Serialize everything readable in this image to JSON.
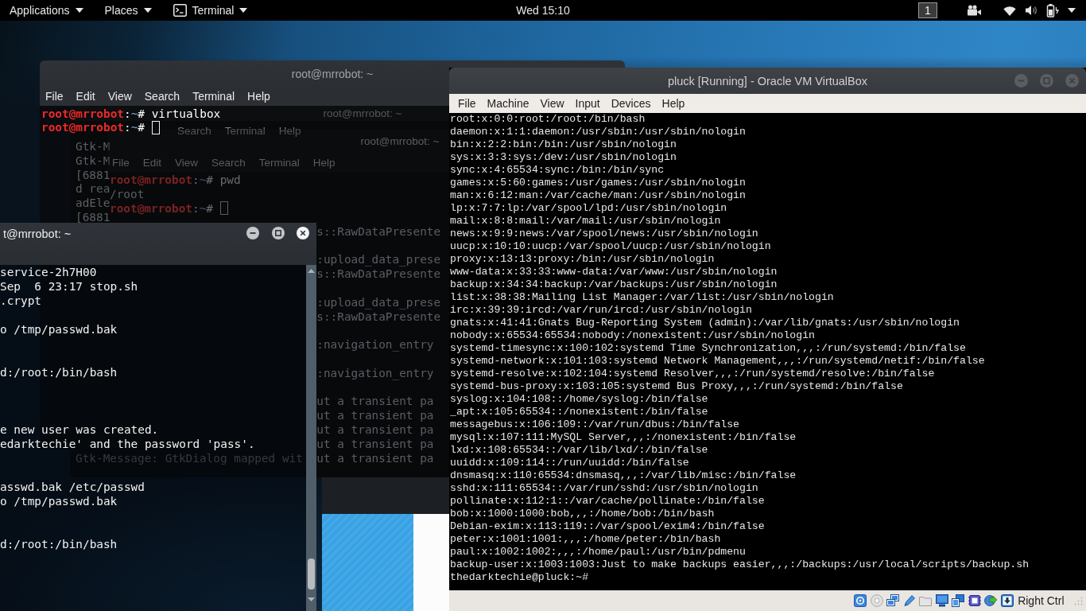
{
  "top_bar": {
    "menus": [
      {
        "kind": "menu",
        "label": "Applications"
      },
      {
        "kind": "menu",
        "label": "Places"
      },
      {
        "kind": "app",
        "label": "Terminal"
      }
    ],
    "clock": "Wed 15:10",
    "workspace": "1"
  },
  "terminal_windows": [
    {
      "kind": "behind",
      "title": "root@mrrobot: ~",
      "menu": [
        "Search",
        "Terminal",
        "Help"
      ],
      "lines": [
        {
          "text": "Gtk-M"
        },
        {
          "text": "Gtk-M"
        },
        {
          "text": "[6881"
        },
        {
          "text": "d rea"
        },
        {
          "text": "adEle"
        },
        {
          "text": "[6881"
        },
        {
          "right": "s::RawDataPresente"
        },
        {
          "right": ":upload_data_prese"
        },
        {
          "right": "s::RawDataPresente"
        },
        {
          "right": ":upload_data_prese"
        },
        {
          "right": "s::RawDataPresente"
        },
        {
          "right": ":navigation_entry"
        },
        {
          "right": ":navigation_entry"
        },
        {
          "right": "ut a transient pa"
        },
        {
          "right": "ut a transient pa"
        },
        {
          "right": "ut a transient pa"
        },
        {
          "right": "ut a transient pa"
        },
        {
          "text": "Gtk-Message: GtkDialog mapped wit",
          "right": "ut a transient pa"
        }
      ]
    },
    {
      "kind": "behind",
      "title": "root@mrrobot: ~",
      "menu": [
        "File",
        "Edit",
        "View",
        "Search",
        "Terminal",
        "Help"
      ],
      "lines": [
        {
          "segments": [
            {
              "kind": "user",
              "text": "root@mrrobot"
            },
            {
              "kind": "plain",
              "text": ":"
            },
            {
              "kind": "path",
              "text": "~"
            },
            {
              "kind": "plain",
              "text": "# pwd"
            }
          ],
          "cursor": false
        },
        {
          "text": "/root",
          "cursor": false
        },
        {
          "segments": [
            {
              "kind": "user",
              "text": "root@mrrobot"
            },
            {
              "kind": "plain",
              "text": ":"
            },
            {
              "kind": "path",
              "text": "~"
            },
            {
              "kind": "plain",
              "text": "#"
            }
          ],
          "cursor": true
        }
      ]
    },
    {
      "kind": "front",
      "title": "root@mrrobot: ~",
      "menu": [
        "File",
        "Edit",
        "View",
        "Search",
        "Terminal",
        "Help"
      ],
      "lines": [
        {
          "segments": [
            {
              "kind": "user",
              "text": "root@mrrobot"
            },
            {
              "kind": "plain",
              "text": ":"
            },
            {
              "kind": "path",
              "text": "~"
            },
            {
              "kind": "plain",
              "text": "# virtualbox"
            }
          ],
          "cursor": false
        },
        {
          "segments": [
            {
              "kind": "user",
              "text": "root@mrrobot"
            },
            {
              "kind": "plain",
              "text": ":"
            },
            {
              "kind": "path",
              "text": "~"
            },
            {
              "kind": "plain",
              "text": "#"
            }
          ],
          "cursor": true
        }
      ]
    },
    {
      "kind": "front",
      "title": "t@mrrobot: ~",
      "lines": [
        {
          "text": "service-2h7H00"
        },
        {
          "text": "Sep  6 23:17 stop.sh"
        },
        {
          "text": ".crypt"
        },
        {
          "text": "o /tmp/passwd.bak"
        },
        {
          "text": "d:/root:/bin/bash"
        },
        {
          "text": "e new user was created."
        },
        {
          "text": "edarktechie' and the password 'pass'."
        },
        {
          "text": "asswd.bak /etc/passwd"
        },
        {
          "text": "o /tmp/passwd.bak"
        },
        {
          "text": "d:/root:/bin/bash"
        }
      ]
    }
  ],
  "virtualbox_window": {
    "title": "pluck [Running] - Oracle VM VirtualBox",
    "menu": [
      "File",
      "Machine",
      "View",
      "Input",
      "Devices",
      "Help"
    ],
    "console_lines": [
      "root:x:0:0:root:/root:/bin/bash",
      "daemon:x:1:1:daemon:/usr/sbin:/usr/sbin/nologin",
      "bin:x:2:2:bin:/bin:/usr/sbin/nologin",
      "sys:x:3:3:sys:/dev:/usr/sbin/nologin",
      "sync:x:4:65534:sync:/bin:/bin/sync",
      "games:x:5:60:games:/usr/games:/usr/sbin/nologin",
      "man:x:6:12:man:/var/cache/man:/usr/sbin/nologin",
      "lp:x:7:7:lp:/var/spool/lpd:/usr/sbin/nologin",
      "mail:x:8:8:mail:/var/mail:/usr/sbin/nologin",
      "news:x:9:9:news:/var/spool/news:/usr/sbin/nologin",
      "uucp:x:10:10:uucp:/var/spool/uucp:/usr/sbin/nologin",
      "proxy:x:13:13:proxy:/bin:/usr/sbin/nologin",
      "www-data:x:33:33:www-data:/var/www:/usr/sbin/nologin",
      "backup:x:34:34:backup:/var/backups:/usr/sbin/nologin",
      "list:x:38:38:Mailing List Manager:/var/list:/usr/sbin/nologin",
      "irc:x:39:39:ircd:/var/run/ircd:/usr/sbin/nologin",
      "gnats:x:41:41:Gnats Bug-Reporting System (admin):/var/lib/gnats:/usr/sbin/nologin",
      "nobody:x:65534:65534:nobody:/nonexistent:/usr/sbin/nologin",
      "systemd-timesync:x:100:102:systemd Time Synchronization,,,:/run/systemd:/bin/false",
      "systemd-network:x:101:103:systemd Network Management,,,:/run/systemd/netif:/bin/false",
      "systemd-resolve:x:102:104:systemd Resolver,,,:/run/systemd/resolve:/bin/false",
      "systemd-bus-proxy:x:103:105:systemd Bus Proxy,,,:/run/systemd:/bin/false",
      "syslog:x:104:108::/home/syslog:/bin/false",
      "_apt:x:105:65534::/nonexistent:/bin/false",
      "messagebus:x:106:109::/var/run/dbus:/bin/false",
      "mysql:x:107:111:MySQL Server,,,:/nonexistent:/bin/false",
      "lxd:x:108:65534::/var/lib/lxd/:/bin/false",
      "uuidd:x:109:114::/run/uuidd:/bin/false",
      "dnsmasq:x:110:65534:dnsmasq,,,:/var/lib/misc:/bin/false",
      "sshd:x:111:65534::/var/run/sshd:/usr/sbin/nologin",
      "pollinate:x:112:1::/var/cache/pollinate:/bin/false",
      "bob:x:1000:1000:bob,,,:/home/bob:/bin/bash",
      "Debian-exim:x:113:119::/var/spool/exim4:/bin/false",
      "peter:x:1001:1001:,,,:/home/peter:/bin/bash",
      "paul:x:1002:1002:,,,:/home/paul:/usr/bin/pdmenu",
      "backup-user:x:1003:1003:Just to make backups easier,,,:/backups:/usr/local/scripts/backup.sh",
      "thedarktechie@pluck:~#"
    ],
    "host_key": "Right Ctrl"
  }
}
